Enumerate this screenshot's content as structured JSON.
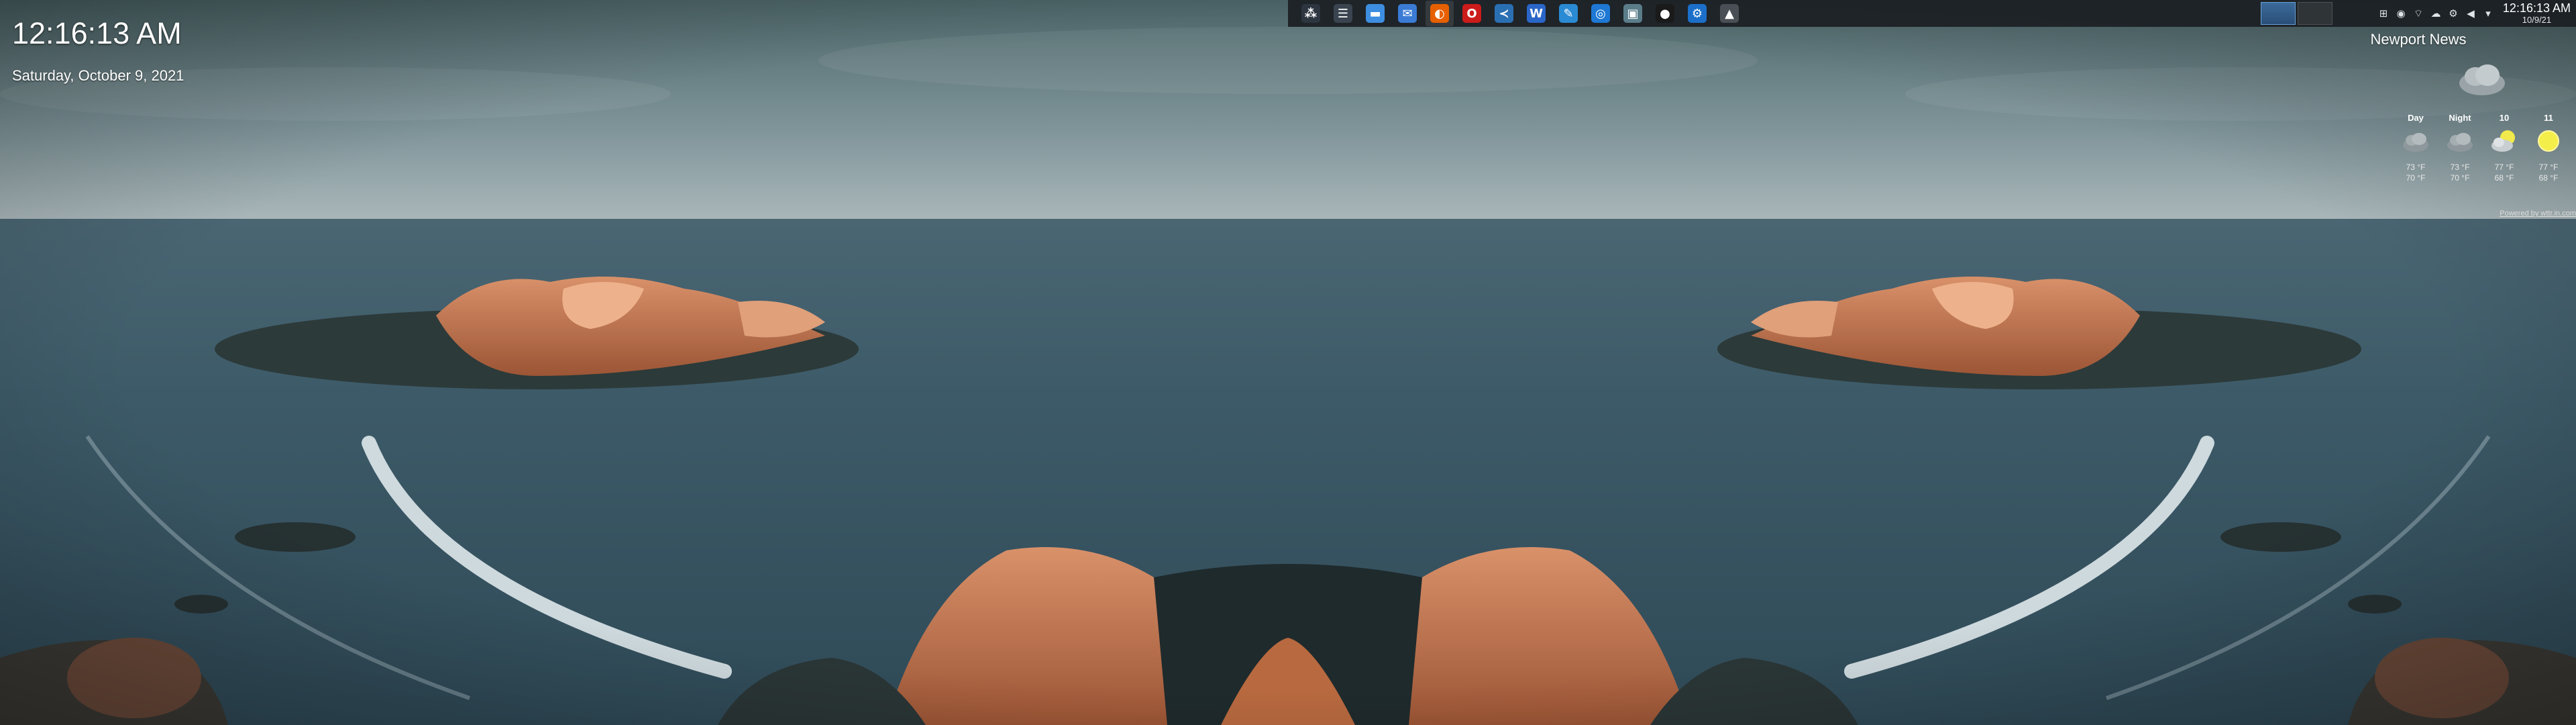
{
  "desktop": {
    "clock": {
      "time": "12:16:13 AM",
      "date": "Saturday, October 9, 2021"
    }
  },
  "panel": {
    "tasks": [
      {
        "name": "app-launcher",
        "icon": "app-launcher-icon",
        "color": "#2d3540"
      },
      {
        "name": "task-manager",
        "icon": "task-manager-icon",
        "color": "#3a4450"
      },
      {
        "name": "file-manager",
        "icon": "folder-icon",
        "color": "#3d8ee0"
      },
      {
        "name": "email-client",
        "icon": "mail-icon",
        "color": "#3a7bd5"
      },
      {
        "name": "firefox",
        "icon": "firefox-icon",
        "color": "#e66000"
      },
      {
        "name": "opera",
        "icon": "opera-icon",
        "color": "#cc1b1b"
      },
      {
        "name": "vs-code",
        "icon": "code-editor-icon",
        "color": "#2b6fb3"
      },
      {
        "name": "word-processor",
        "icon": "document-icon",
        "color": "#2a66c8"
      },
      {
        "name": "chat-app",
        "icon": "chat-icon",
        "color": "#2a8ad3"
      },
      {
        "name": "browser",
        "icon": "globe-icon",
        "color": "#1e78d4"
      },
      {
        "name": "image-viewer",
        "icon": "image-icon",
        "color": "#5b7d8a"
      },
      {
        "name": "obs-studio",
        "icon": "obs-icon",
        "color": "#1a1a1a"
      },
      {
        "name": "steam",
        "icon": "steam-icon",
        "color": "#1b6fc9"
      },
      {
        "name": "toolbox",
        "icon": "toolbox-icon",
        "color": "#4a4f55"
      }
    ],
    "tray": [
      "network-icon",
      "circle-icon",
      "wifi-icon",
      "cloud-icon",
      "gear-icon",
      "volume-icon",
      "expand-arrow-icon"
    ],
    "clock": {
      "time": "12:16:13 AM",
      "date": "10/9/21"
    }
  },
  "weather": {
    "city": "Newport News",
    "credit": "Powered by wttr.in.com",
    "forecast": [
      {
        "label": "Day",
        "icon": "cloud-icon",
        "hi": "73 °F",
        "lo": "70 °F"
      },
      {
        "label": "Night",
        "icon": "cloud-icon",
        "hi": "73 °F",
        "lo": "70 °F"
      },
      {
        "label": "10",
        "icon": "partly-sunny-icon",
        "hi": "77 °F",
        "lo": "68 °F"
      },
      {
        "label": "11",
        "icon": "sun-icon",
        "hi": "77 °F",
        "lo": "68 °F"
      }
    ]
  }
}
